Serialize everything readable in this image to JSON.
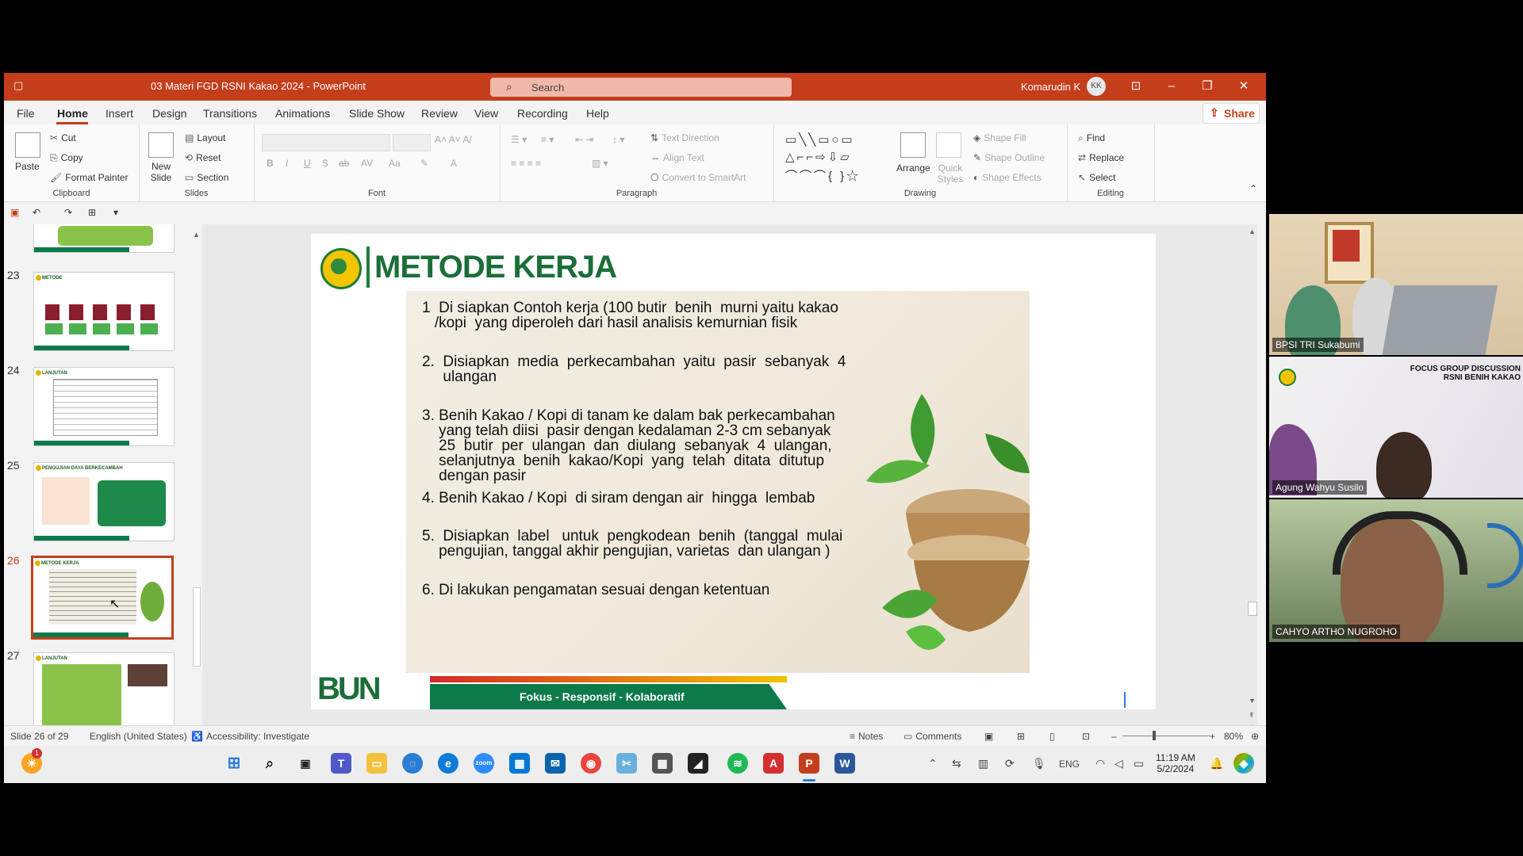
{
  "window": {
    "doc_title": "03 Materi FGD RSNI Kakao 2024  -  PowerPoint",
    "search_placeholder": "Search",
    "user_name": "Komarudin K",
    "user_initials": "KK"
  },
  "menu": {
    "items": [
      "File",
      "Home",
      "Insert",
      "Design",
      "Transitions",
      "Animations",
      "Slide Show",
      "Review",
      "View",
      "Recording",
      "Help"
    ],
    "share_label": "Share"
  },
  "ribbon": {
    "clipboard": {
      "paste": "Paste",
      "cut": "Cut",
      "copy": "Copy",
      "format_painter": "Format Painter",
      "label": "Clipboard"
    },
    "slides": {
      "new_slide": "New Slide",
      "layout": "Layout",
      "reset": "Reset",
      "section": "Section",
      "label": "Slides"
    },
    "font": {
      "label": "Font"
    },
    "paragraph": {
      "text_direction": "Text Direction",
      "align_text": "Align Text",
      "convert": "Convert to SmartArt",
      "label": "Paragraph"
    },
    "drawing": {
      "arrange": "Arrange",
      "quick_styles": "Quick Styles",
      "shape_fill": "Shape Fill",
      "shape_outline": "Shape Outline",
      "shape_effects": "Shape Effects",
      "label": "Drawing"
    },
    "editing": {
      "find": "Find",
      "replace": "Replace",
      "select": "Select",
      "label": "Editing"
    }
  },
  "thumbnails": [
    {
      "num": "23",
      "title": "METODE"
    },
    {
      "num": "24",
      "title": "LANJUTAN"
    },
    {
      "num": "25",
      "title": "PENGUJIAN DAYA BERKECAMBAH"
    },
    {
      "num": "26",
      "title": "METODE KERJA"
    },
    {
      "num": "27",
      "title": "LANJUTAN"
    }
  ],
  "slide": {
    "title": "METODE KERJA",
    "steps": [
      [
        "1  Di siapkan Contoh kerja (100 butir  benih  murni yaitu kakao",
        "   /kopi  yang diperoleh dari hasil analisis kemurnian fisik"
      ],
      [
        "2.  Disiapkan  media  perkecambahan  yaitu  pasir  sebanyak  4",
        "     ulangan"
      ],
      [
        "3. Benih Kakao / Kopi di tanam ke dalam bak perkecambahan",
        "    yang telah diisi  pasir dengan kedalaman 2-3 cm sebanyak",
        "    25  butir  per  ulangan  dan  diulang  sebanyak  4  ulangan,",
        "    selanjutnya  benih  kakao/Kopi  yang  telah  ditata  ditutup",
        "    dengan pasir"
      ],
      [
        "4. Benih Kakao / Kopi  di siram dengan air  hingga  lembab"
      ],
      [
        "5.  Disiapkan  label   untuk  pengkodean  benih  (tanggal  mulai",
        "    pengujian, tanggal akhir pengujian, varietas  dan ulangan )"
      ],
      [
        "6. Di lakukan pengamatan sesuai dengan ketentuan"
      ]
    ],
    "footer_text": "Fokus - Responsif - Kolaboratif",
    "footer_logo": "BUN"
  },
  "status": {
    "slide_count": "Slide 26 of 29",
    "language": "English (United States)",
    "accessibility": "Accessibility: Investigate",
    "notes": "Notes",
    "comments": "Comments",
    "zoom": "80%"
  },
  "taskbar": {
    "time": "11:19 AM",
    "date": "5/2/2024",
    "lang": "ENG",
    "badge": "1"
  },
  "video": {
    "participants": [
      "BPSI TRI Sukabumi",
      "Agung Wahyu Susilo",
      "CAHYO ARTHO NUGROHO"
    ],
    "banner_line1": "FOCUS GROUP DISCUSSION",
    "banner_line2": "RSNI BENIH KAKAO"
  },
  "colors": {
    "accent": "#c43e1c",
    "slide_green": "#1b6e39"
  }
}
